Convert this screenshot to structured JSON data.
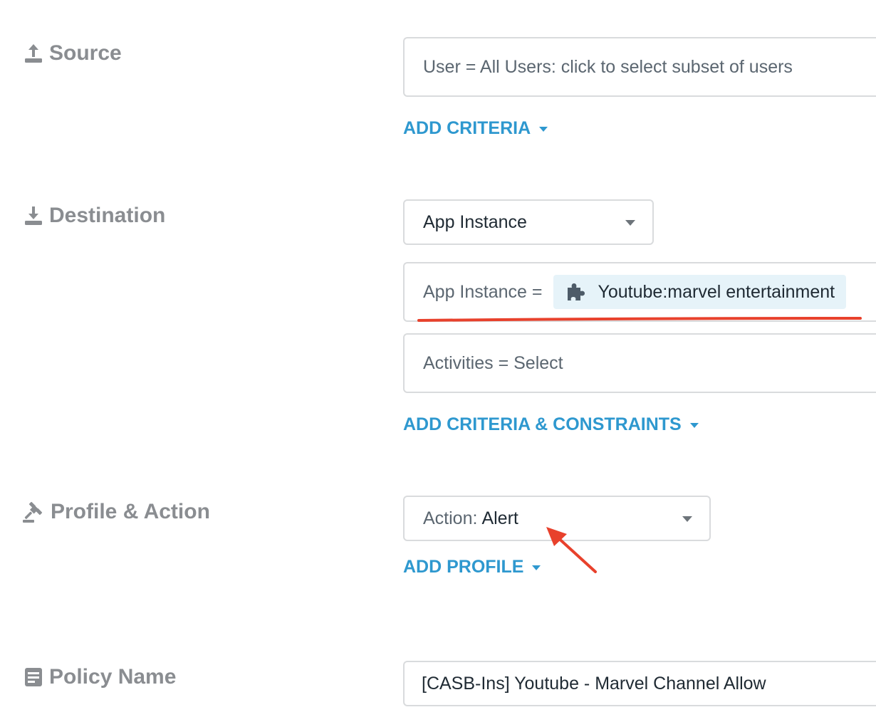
{
  "source": {
    "label": "Source",
    "icon": "upload-icon",
    "user_field": "User = All Users: click to select subset of users",
    "add_criteria": "ADD CRITERIA"
  },
  "destination": {
    "label": "Destination",
    "icon": "download-icon",
    "type_select": "App Instance",
    "app_instance_prefix": "App Instance =",
    "app_instance_chip": "Youtube:marvel entertainment",
    "chip_icon": "puzzle-icon",
    "activities": "Activities = Select",
    "add_criteria_constraints": "ADD CRITERIA & CONSTRAINTS"
  },
  "profile_action": {
    "label": "Profile & Action",
    "icon": "gavel-icon",
    "action_prefix": "Action:",
    "action_value": "Alert",
    "add_profile": "ADD PROFILE"
  },
  "policy": {
    "label": "Policy Name",
    "icon": "document-icon",
    "name_value": "[CASB-Ins] Youtube - Marvel Channel Allow"
  },
  "colors": {
    "link": "#2e98cf",
    "label_gray": "#8a8d91",
    "annotation_red": "#e8412c",
    "chip_bg": "#e6f3f9"
  }
}
